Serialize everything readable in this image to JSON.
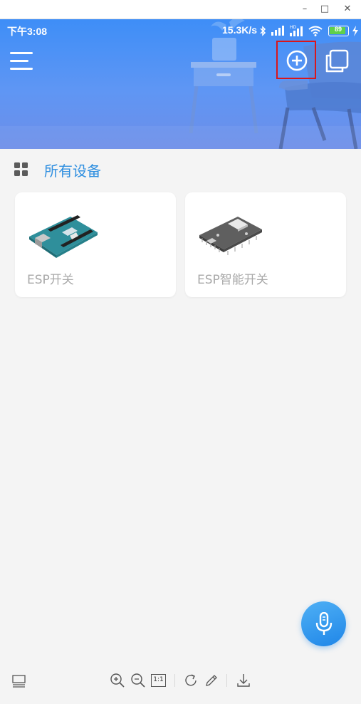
{
  "window": {
    "minimize_glyph": "–",
    "maximize_glyph": "□",
    "close_glyph": "✕"
  },
  "status_bar": {
    "time": "下午3:08",
    "speed": "15.3K/s",
    "battery": "89",
    "icons": [
      "bluetooth-icon",
      "signal-icon",
      "hd-signal-icon",
      "wifi-icon",
      "battery-icon",
      "charging-icon"
    ]
  },
  "header": {
    "icons": [
      "menu-icon",
      "add-circle-icon",
      "copy-icon"
    ],
    "highlight_color": "#d9161b",
    "gradient_colors": [
      "#3e8ef7",
      "#6d8ee8"
    ]
  },
  "section": {
    "title": "所有设备",
    "icon": "grid-icon",
    "accent_color": "#2f8fe0"
  },
  "devices": [
    {
      "label": "ESP开关",
      "icon": "arduino-board-icon"
    },
    {
      "label": "ESP智能开关",
      "icon": "esp-module-icon"
    }
  ],
  "fab": {
    "icon": "microphone-icon"
  },
  "toolbar": {
    "icons": [
      "panel-icon",
      "zoom-in-icon",
      "zoom-out-icon",
      "actual-size-icon",
      "rotate-icon",
      "edit-icon",
      "download-icon"
    ],
    "actual_size_label": "1:1"
  }
}
